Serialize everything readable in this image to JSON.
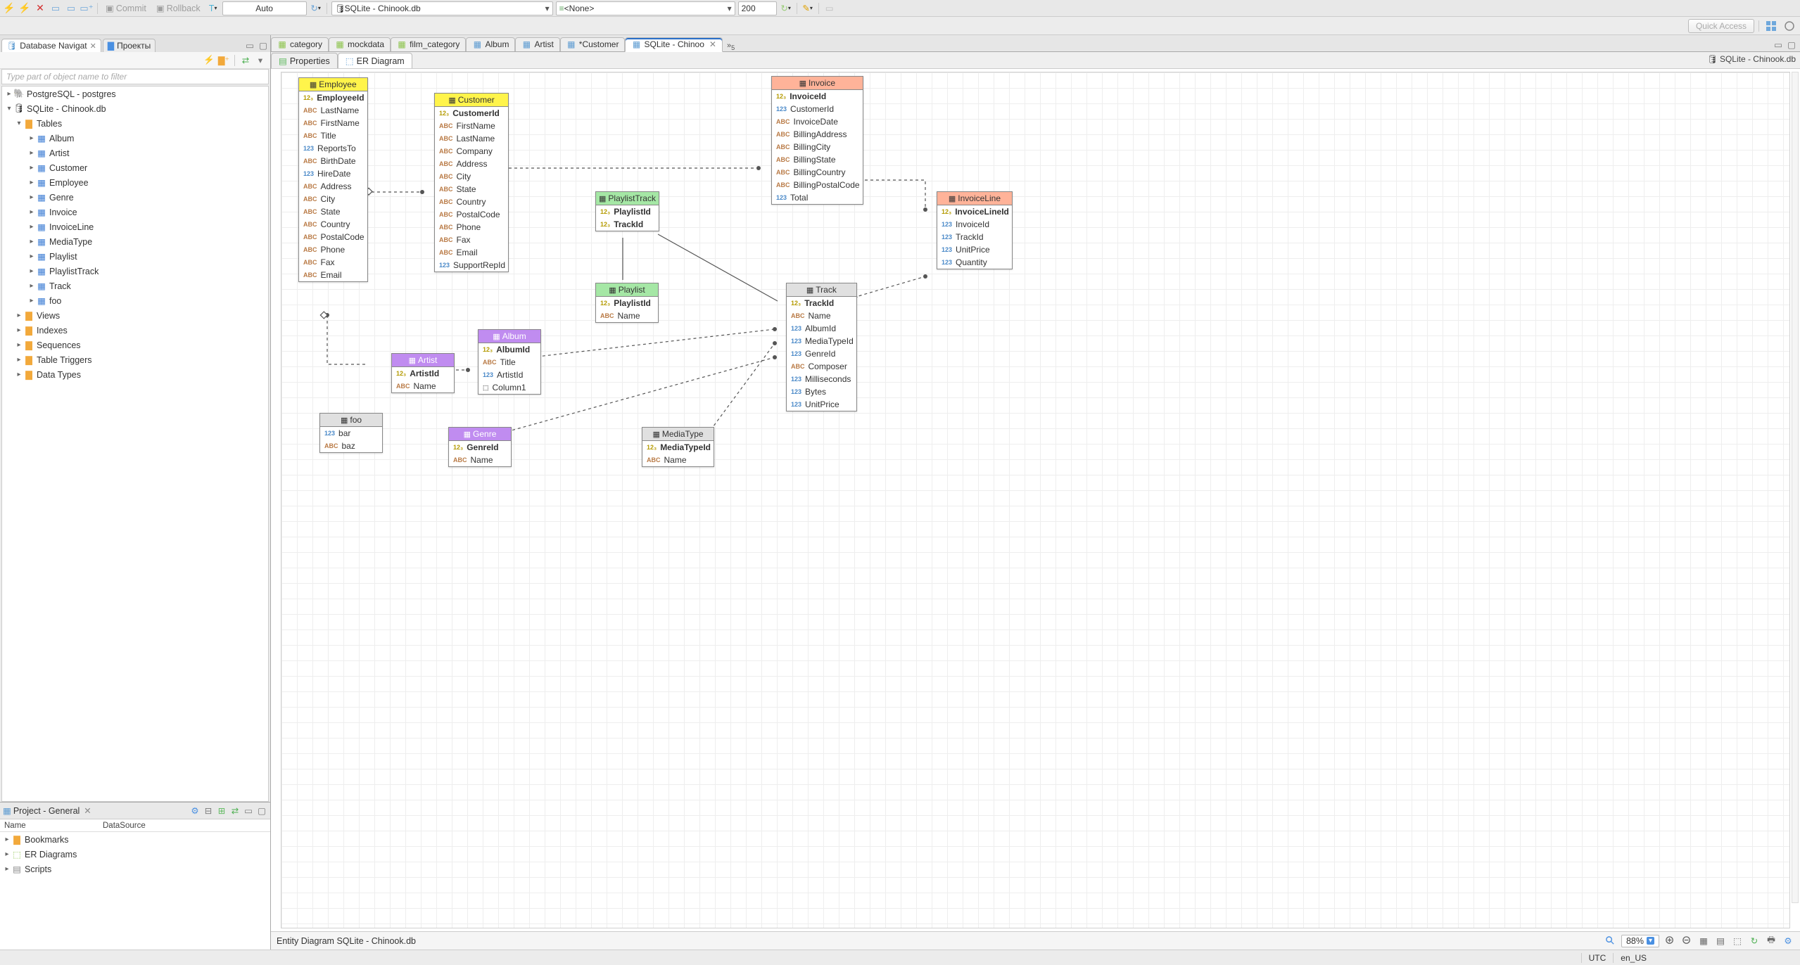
{
  "toolbar": {
    "commit": "Commit",
    "rollback": "Rollback",
    "mode": "Auto",
    "conn_combo": "SQLite - Chinook.db",
    "schema_combo": "<None>",
    "limit": "200"
  },
  "quick_access": "Quick Access",
  "nav_panel": {
    "tab1": "Database Navigat",
    "tab2": "Проекты",
    "filter_ph": "Type part of object name to filter",
    "tree": {
      "pg": "PostgreSQL - postgres",
      "sqlite": "SQLite - Chinook.db",
      "tables_group": "Tables",
      "tables": [
        "Album",
        "Artist",
        "Customer",
        "Employee",
        "Genre",
        "Invoice",
        "InvoiceLine",
        "MediaType",
        "Playlist",
        "PlaylistTrack",
        "Track",
        "foo"
      ],
      "views": "Views",
      "indexes": "Indexes",
      "sequences": "Sequences",
      "triggers": "Table Triggers",
      "datatypes": "Data Types"
    }
  },
  "project_panel": {
    "title": "Project - General",
    "col_name": "Name",
    "col_ds": "DataSource",
    "items": [
      "Bookmarks",
      "ER Diagrams",
      "Scripts"
    ]
  },
  "editor_tabs": [
    "category",
    "mockdata",
    "film_category",
    "Album",
    "Artist",
    "*Customer",
    "SQLite - Chinoo"
  ],
  "more_tabs": "5",
  "subtabs": {
    "properties": "Properties",
    "er": "ER Diagram"
  },
  "crumb": "SQLite - Chinook.db",
  "entities": {
    "Employee": {
      "header": "Employee",
      "cols": [
        [
          "k",
          "EmployeeId",
          true
        ],
        [
          "abc",
          "LastName"
        ],
        [
          "abc",
          "FirstName"
        ],
        [
          "abc",
          "Title"
        ],
        [
          "123",
          "ReportsTo"
        ],
        [
          "abc",
          "BirthDate"
        ],
        [
          "123",
          "HireDate"
        ],
        [
          "abc",
          "Address"
        ],
        [
          "abc",
          "City"
        ],
        [
          "abc",
          "State"
        ],
        [
          "abc",
          "Country"
        ],
        [
          "abc",
          "PostalCode"
        ],
        [
          "abc",
          "Phone"
        ],
        [
          "abc",
          "Fax"
        ],
        [
          "abc",
          "Email"
        ]
      ]
    },
    "Customer": {
      "header": "Customer",
      "cols": [
        [
          "k",
          "CustomerId",
          true
        ],
        [
          "abc",
          "FirstName"
        ],
        [
          "abc",
          "LastName"
        ],
        [
          "abc",
          "Company"
        ],
        [
          "abc",
          "Address"
        ],
        [
          "abc",
          "City"
        ],
        [
          "abc",
          "State"
        ],
        [
          "abc",
          "Country"
        ],
        [
          "abc",
          "PostalCode"
        ],
        [
          "abc",
          "Phone"
        ],
        [
          "abc",
          "Fax"
        ],
        [
          "abc",
          "Email"
        ],
        [
          "123",
          "SupportRepId"
        ]
      ]
    },
    "Invoice": {
      "header": "Invoice",
      "cols": [
        [
          "k",
          "InvoiceId",
          true
        ],
        [
          "123",
          "CustomerId"
        ],
        [
          "abc",
          "InvoiceDate"
        ],
        [
          "abc",
          "BillingAddress"
        ],
        [
          "abc",
          "BillingCity"
        ],
        [
          "abc",
          "BillingState"
        ],
        [
          "abc",
          "BillingCountry"
        ],
        [
          "abc",
          "BillingPostalCode"
        ],
        [
          "123",
          "Total"
        ]
      ]
    },
    "InvoiceLine": {
      "header": "InvoiceLine",
      "cols": [
        [
          "k",
          "InvoiceLineId",
          true
        ],
        [
          "123",
          "InvoiceId"
        ],
        [
          "123",
          "TrackId"
        ],
        [
          "123",
          "UnitPrice"
        ],
        [
          "123",
          "Quantity"
        ]
      ]
    },
    "PlaylistTrack": {
      "header": "PlaylistTrack",
      "cols": [
        [
          "k",
          "PlaylistId",
          true
        ],
        [
          "k",
          "TrackId",
          true
        ]
      ]
    },
    "Playlist": {
      "header": "Playlist",
      "cols": [
        [
          "k",
          "PlaylistId",
          true
        ],
        [
          "abc",
          "Name"
        ]
      ]
    },
    "Track": {
      "header": "Track",
      "cols": [
        [
          "k",
          "TrackId",
          true
        ],
        [
          "abc",
          "Name"
        ],
        [
          "123",
          "AlbumId"
        ],
        [
          "123",
          "MediaTypeId"
        ],
        [
          "123",
          "GenreId"
        ],
        [
          "abc",
          "Composer"
        ],
        [
          "123",
          "Milliseconds"
        ],
        [
          "123",
          "Bytes"
        ],
        [
          "123",
          "UnitPrice"
        ]
      ]
    },
    "Artist": {
      "header": "Artist",
      "cols": [
        [
          "k",
          "ArtistId",
          true
        ],
        [
          "abc",
          "Name"
        ]
      ]
    },
    "Album": {
      "header": "Album",
      "cols": [
        [
          "k",
          "AlbumId",
          true
        ],
        [
          "abc",
          "Title"
        ],
        [
          "123",
          "ArtistId"
        ],
        [
          "oth",
          "Column1"
        ]
      ]
    },
    "Genre": {
      "header": "Genre",
      "cols": [
        [
          "k",
          "GenreId",
          true
        ],
        [
          "abc",
          "Name"
        ]
      ]
    },
    "MediaType": {
      "header": "MediaType",
      "cols": [
        [
          "k",
          "MediaTypeId",
          true
        ],
        [
          "abc",
          "Name"
        ]
      ]
    },
    "foo": {
      "header": "foo",
      "cols": [
        [
          "123",
          "bar"
        ],
        [
          "abc",
          "baz"
        ]
      ]
    }
  },
  "diag_status": "Entity Diagram SQLite - Chinook.db",
  "zoom": "88%",
  "bottom": {
    "tz": "UTC",
    "locale": "en_US"
  }
}
